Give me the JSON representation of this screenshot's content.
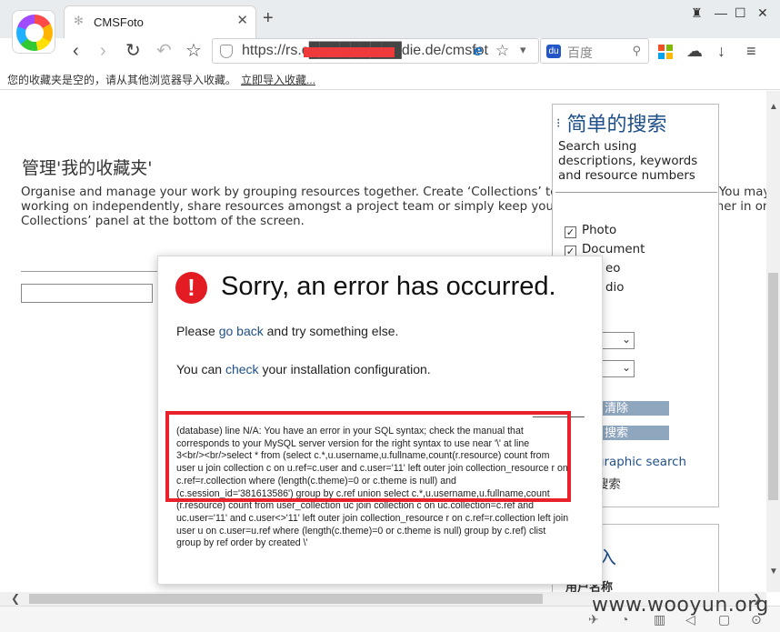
{
  "browser": {
    "tab_title": "CMSFoto",
    "new_tab_label": "+",
    "url": "https://rs.c█████████die.de/cmsfot",
    "search_placeholder": "百度",
    "bookmarks_message": "您的收藏夹是空的，请从其他浏览器导入收藏。",
    "bookmarks_import": "立即导入收藏...",
    "icons": [
      "back-icon",
      "forward-icon",
      "refresh-icon",
      "undo-icon",
      "star-icon",
      "shield-icon",
      "ie-icon",
      "dropdown-icon",
      "paw-icon",
      "search-icon",
      "apps-icon",
      "cloud-icon",
      "download-icon",
      "menu-icon"
    ]
  },
  "page": {
    "heading": "管理'我的收藏夹'",
    "intro_lines": [
      "Organise and manage your work by grouping resources together. Create ‘Collections’ to suit your way of working. You may w",
      "working on independently, share resources amongst a project team or simply keep your favourite resources together in one p",
      "Collections’ panel at the bottom of the screen."
    ]
  },
  "sidebar": {
    "title": "简单的搜索",
    "description": "Search using descriptions, keywords and resource numbers",
    "checkboxes": [
      {
        "label": "Photo",
        "checked": true
      },
      {
        "label": "Document",
        "checked": true
      },
      {
        "label": "eo",
        "checked": false
      },
      {
        "label": "dio",
        "checked": false
      }
    ],
    "buttons": [
      "清除",
      "搜索"
    ],
    "links": [
      "graphic search",
      "搜索"
    ],
    "second_title": "入",
    "second_label": "用户名称"
  },
  "error": {
    "title": "Sorry, an error has occurred.",
    "line1_pre": "Please ",
    "line1_link": "go back",
    "line1_post": " and try something else.",
    "line2_pre": "You can ",
    "line2_link": "check",
    "line2_post": " your installation configuration.",
    "detail": "(database) line N/A: You have an error in your SQL syntax; check the manual that\ncorresponds to your MySQL server version for the right syntax to use near '\\' at line\n3<br/><br/>select * from (select c.*,u.username,u.fullname,count(r.resource) count from\nuser u join collection c on u.ref=c.user and c.user='11' left outer join collection_resource r on\nc.ref=r.collection where (length(c.theme)=0 or c.theme is null) and\n(c.session_id='381613586') group by c.ref union select c.*,u.username,u.fullname,count\n(r.resource) count from user_collection uc join collection c on uc.collection=c.ref and\nuc.user='11' and c.user<>'11' left outer join collection_resource r on c.ref=r.collection left join\nuser u on c.user=u.ref where (length(c.theme)=0 or c.theme is null) group by c.ref) clist\ngroup by ref order by created \\'"
  },
  "watermark": "www.wooyun.org",
  "colors": {
    "error_red": "#e31b23",
    "highlight_red": "#e8212b",
    "link_blue": "#1e4f8a",
    "button_blue": "#8fa6bf"
  }
}
